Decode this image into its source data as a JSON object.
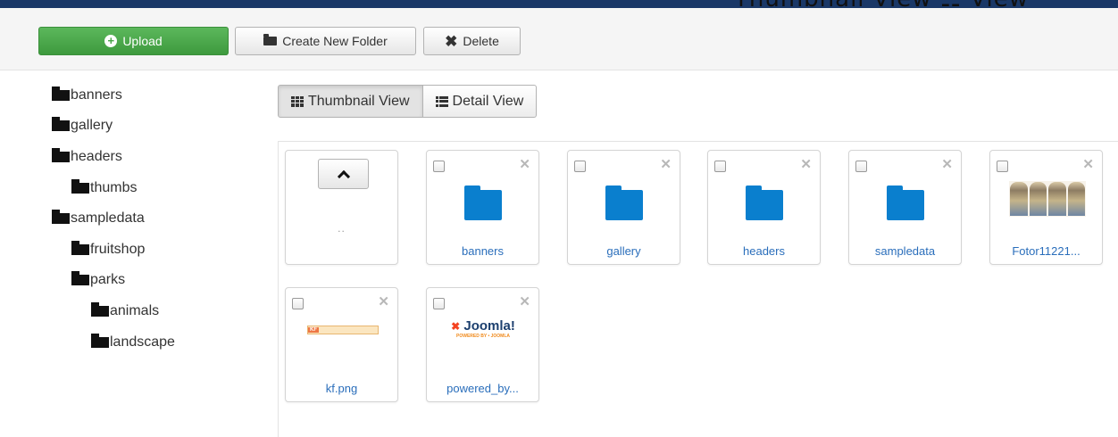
{
  "header": {
    "caption": "Thumbnail View ☷ View"
  },
  "toolbar": {
    "upload_label": "Upload",
    "create_folder_label": "Create New Folder",
    "delete_label": "Delete"
  },
  "tree": [
    {
      "label": "banners"
    },
    {
      "label": "gallery"
    },
    {
      "label": "headers"
    },
    {
      "label": "thumbs"
    },
    {
      "label": "sampledata"
    },
    {
      "label": "fruitshop"
    },
    {
      "label": "parks"
    },
    {
      "label": "animals"
    },
    {
      "label": "landscape"
    }
  ],
  "view_toggle": {
    "thumbnail_label": "Thumbnail View",
    "detail_label": "Detail View",
    "active": "thumbnail"
  },
  "tiles": {
    "up": {
      "label": ".."
    },
    "items": [
      {
        "name": "banners",
        "kind": "folder"
      },
      {
        "name": "gallery",
        "kind": "folder"
      },
      {
        "name": "headers",
        "kind": "folder"
      },
      {
        "name": "sampledata",
        "kind": "folder"
      },
      {
        "name": "Fotor11221...",
        "kind": "image"
      },
      {
        "name": "kf.png",
        "kind": "image",
        "logo_text": "KF"
      },
      {
        "name": "powered_by...",
        "kind": "image",
        "logo_text": "Joomla!",
        "logo_sub": "POWERED BY • JOOMLA"
      }
    ]
  },
  "colors": {
    "primary_blue": "#0a7fce",
    "upload_green": "#46a546",
    "top_bar": "#1a3867",
    "link": "#2a6ebb"
  }
}
